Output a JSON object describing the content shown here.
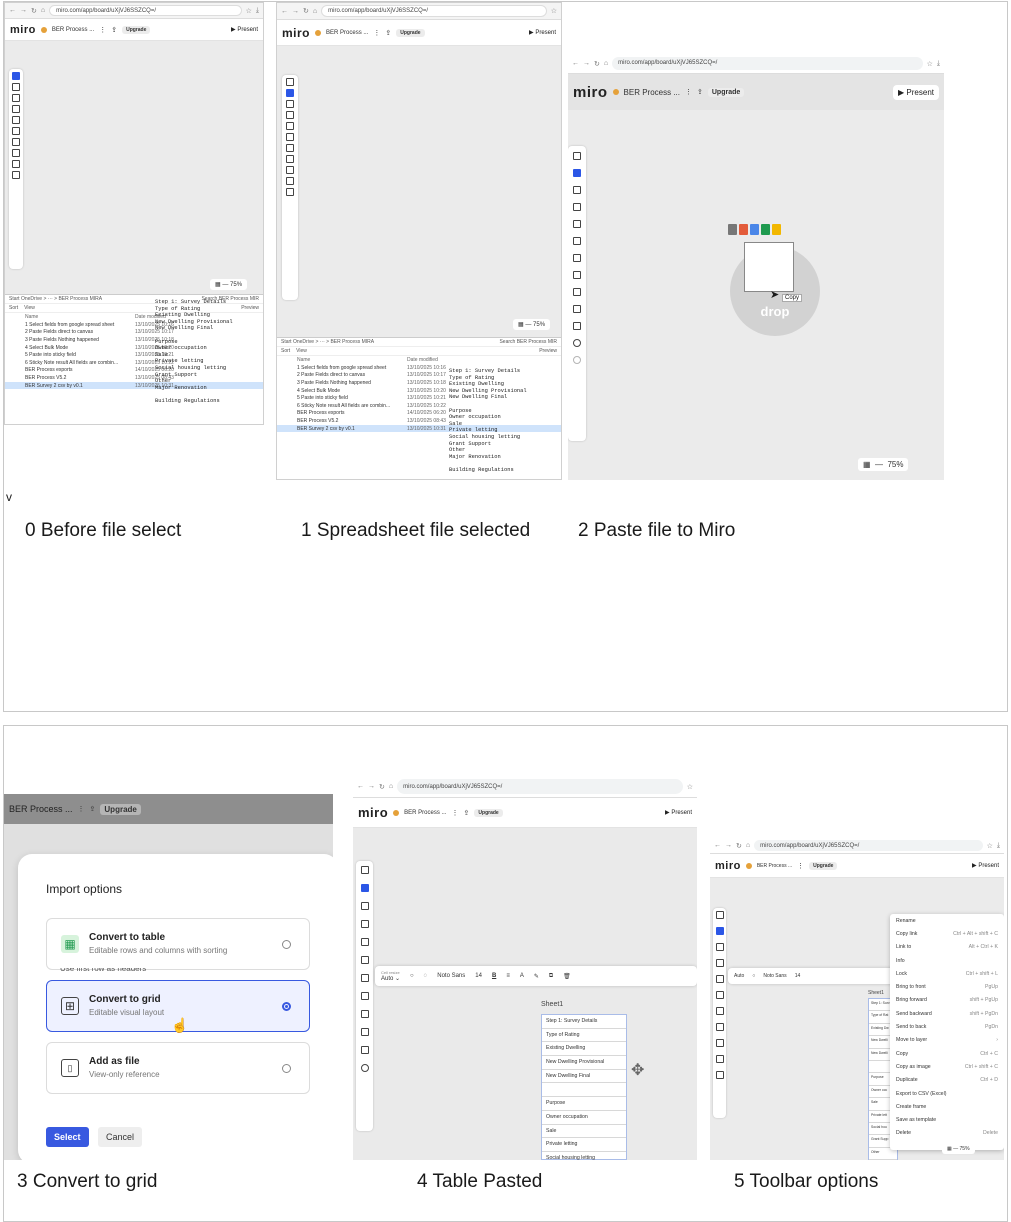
{
  "captions": {
    "c0": "0 Before file select",
    "c1": "1 Spreadsheet file selected",
    "c2": "2 Paste file to Miro",
    "c3": "3 Convert to grid",
    "c4": "4 Table Pasted",
    "c5": "5 Toolbar options",
    "stray": "v"
  },
  "browser": {
    "url_short": "miro.com/app/board/uXjVJ6SSZCQ=/",
    "url_long": "miro.com/app/board/uXjVJ65SZCQ=/"
  },
  "miro": {
    "logo": "miro",
    "board_name": "BER Process ...",
    "board_name_long": "BER Process MIRA",
    "upgrade": "Upgrade",
    "present": "Present",
    "zoom": "75%"
  },
  "explorer": {
    "location": "Start   OneDrive  >  ···  >  BER Process MIRA",
    "search": "Search BER Process MIR",
    "sort": "Sort",
    "view": "View",
    "preview": "Preview",
    "col_name": "Name",
    "col_date": "Date modified",
    "files": [
      {
        "name": "1 Select fields from google spread sheet",
        "date": "13/10/2025 10:16"
      },
      {
        "name": "2 Paste Fields direct to canvas",
        "date": "13/10/2025 10:17"
      },
      {
        "name": "3 Paste Fields Nothing happened",
        "date": "13/10/2025 10:18"
      },
      {
        "name": "4 Select Bulk Mode",
        "date": "13/10/2025 10:20"
      },
      {
        "name": "5 Paste into sticky field",
        "date": "13/10/2025 10:21"
      },
      {
        "name": "6 Sticky Note result All fields are combin...",
        "date": "13/10/2025 10:22"
      },
      {
        "name": "BER Process exports",
        "date": "14/10/2025 06:20"
      },
      {
        "name": "BER Process V5.2",
        "date": "13/10/2025 08:43"
      },
      {
        "name": "BER Survey 2 csv by v0.1",
        "date": "13/10/2025 10:31"
      }
    ],
    "preview_lines": [
      "Step 1: Survey Details",
      "Type of Rating",
      "Existing Dwelling",
      "New Dwelling Provisional",
      "New Dwelling Final",
      "",
      "Purpose",
      "Owner occupation",
      "Sale",
      "Private letting",
      "Social housing letting",
      "Grant Support",
      "Other",
      "Major Renovation",
      "",
      "Building Regulations"
    ]
  },
  "drop": {
    "label": "drop",
    "copy": "Copy"
  },
  "import": {
    "title": "Import options",
    "partial": "Use first row as headers",
    "options": [
      {
        "title": "Convert to table",
        "subtitle": "Editable rows and columns with sorting"
      },
      {
        "title": "Convert to grid",
        "subtitle": "Editable visual layout"
      },
      {
        "title": "Add as file",
        "subtitle": "View-only reference"
      }
    ],
    "select": "Select",
    "cancel": "Cancel"
  },
  "sheet": {
    "name": "Sheet1",
    "cell_resize": "Cell resize",
    "cell_resize_value": "Auto",
    "font": "Noto Sans",
    "font_size": "14",
    "rows": [
      "Step 1: Survey Details",
      "Type of Rating",
      "Existing Dwelling",
      "New Dwelling Provisional",
      "New Dwelling Final",
      "",
      "Purpose",
      "Owner occupation",
      "Sale",
      "Private letting",
      "Social housing letting",
      "Grant Support"
    ]
  },
  "context_menu": [
    {
      "label": "Rename",
      "shortcut": ""
    },
    {
      "label": "Copy link",
      "shortcut": "Ctrl + Alt + shift + C"
    },
    {
      "label": "Link to",
      "shortcut": "Alt + Ctrl + K"
    },
    {
      "label": "Info",
      "shortcut": ""
    },
    {
      "label": "Lock",
      "shortcut": "Ctrl + shift + L"
    },
    {
      "label": "Bring to front",
      "shortcut": "PgUp"
    },
    {
      "label": "Bring forward",
      "shortcut": "shift + PgUp"
    },
    {
      "label": "Send backward",
      "shortcut": "shift + PgDn"
    },
    {
      "label": "Send to back",
      "shortcut": "PgDn"
    },
    {
      "label": "Move to layer",
      "shortcut": "›"
    },
    {
      "label": "Copy",
      "shortcut": "Ctrl + C"
    },
    {
      "label": "Copy as image",
      "shortcut": "Ctrl + shift + C"
    },
    {
      "label": "Duplicate",
      "shortcut": "Ctrl + D"
    },
    {
      "label": "Export to CSV (Excel)",
      "shortcut": ""
    },
    {
      "label": "Create frame",
      "shortcut": ""
    },
    {
      "label": "Save as template",
      "shortcut": ""
    },
    {
      "label": "Delete",
      "shortcut": "Delete"
    }
  ],
  "mini_rows_5": [
    "Step 1: Surv",
    "Type of Rat",
    "Existing Dw",
    "New Dwelli",
    "New Dwelli",
    "",
    "Purpose",
    "Owner occ",
    "Sale",
    "Private lett",
    "Social hou",
    "Grant Supp",
    "Other"
  ],
  "colors": {
    "accent": "#2b56e6",
    "modal_accent": "#3859e0",
    "dot": "#e5a13a"
  }
}
